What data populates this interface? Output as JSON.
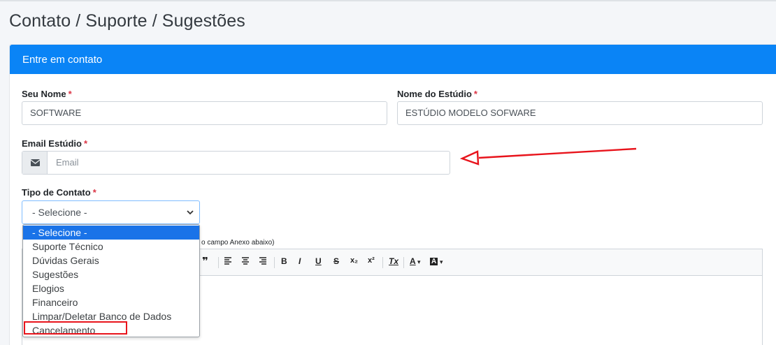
{
  "page": {
    "title": "Contato / Suporte / Sugestões"
  },
  "card": {
    "header": "Entre em contato"
  },
  "form": {
    "required_mark": "*",
    "nome": {
      "label": "Seu Nome",
      "value": "SOFTWARE"
    },
    "estudio": {
      "label": "Nome do Estúdio",
      "value": "ESTÚDIO MODELO SOFWARE"
    },
    "email": {
      "label": "Email Estúdio",
      "placeholder": "Email",
      "icon": "envelope-icon"
    },
    "tipo": {
      "label": "Tipo de Contato",
      "selected": "- Selecione -",
      "options": [
        "- Selecione -",
        "Suporte Técnico",
        "Dúvidas Gerais",
        "Sugestões",
        "Elogios",
        "Financeiro",
        "Limpar/Deletar Banco de Dados",
        "Cancelamento"
      ]
    },
    "hint": "o campo Anexo abaixo)"
  },
  "editor": {
    "toolbar": {
      "quote": "❞",
      "bold": "B",
      "italic": "I",
      "underline": "U",
      "strike": "S",
      "subscript": "x₂",
      "superscript": "x²",
      "clear_format": "Tx",
      "font_color": "A",
      "bg_color": "A"
    }
  },
  "colors": {
    "header_bg": "#0a84f6",
    "required": "#dc3545",
    "annotation": "#e8141c",
    "option_selected": "#1a73e8"
  }
}
